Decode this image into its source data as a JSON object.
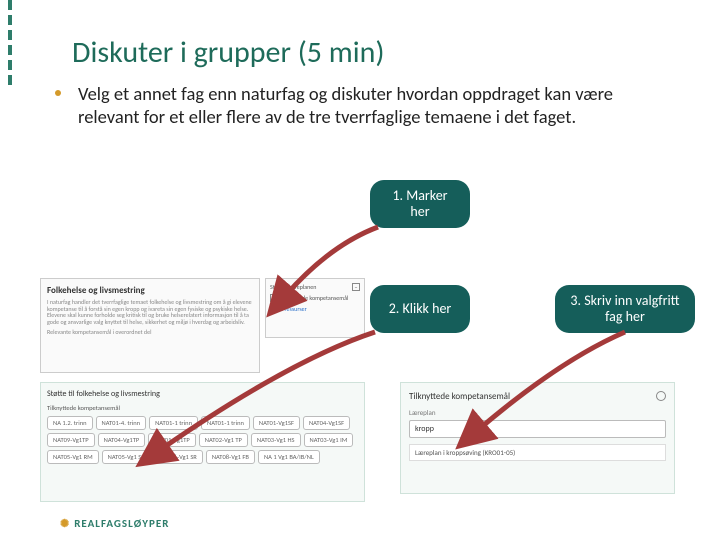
{
  "title": "Diskuter i grupper (5 min)",
  "body": "Velg et annet fag enn naturfag og diskuter hvordan oppdraget kan være relevant for et eller flere av de tre tverrfaglige temaene i det faget.",
  "callouts": {
    "c1": "1. Marker her",
    "c2": "2. Klikk her",
    "c3": "3. Skriv inn valgfritt fag her"
  },
  "shot1": {
    "heading": "Folkehelse og livsmestring",
    "blurb": "I naturfag handler det tverrfaglige temaet folkehelse og livsmestring om å gi elevene kompetanse til å forstå sin egen kropp og ivareta sin egen fysiske og psykiske helse. Elevene skal kunne forholde seg kritisk til og bruke helserelatert informasjon til å ta gode og ansvarlige valg knyttet til helse, sikkerhet og miljø i hverdag og arbeidsliv.",
    "sub": "Relevante kompetansemål i overordnet del"
  },
  "shot2": {
    "heading": "Støtte i læreplanen",
    "chk_label": "Tilknyttede kompetansemål",
    "link": "Vis ressurser"
  },
  "shot3": {
    "heading": "Støtte til folkehelse og livsmestring",
    "sub": "Tilknyttede kompetansemål",
    "pills": [
      "NA 1.2. trinn",
      "NAT01‑4. trinn",
      "NAT01‑1 trinn",
      "NAT01‑1 trinn",
      "NAT01‑Vg1SF",
      "NAT04‑Vg1SF",
      "NAT09‑Vg1TP",
      "NAT04‑Vg1TP",
      "NET01‑Vg1TP",
      "NAT02‑Vg1 TP",
      "NAT03‑Vg1 HS",
      "NAT03‑Vg1 IM",
      "NAT05‑Vg1 RM",
      "NAT05‑Vg1 SR",
      "NAT06‑Vg1 SR",
      "NAT08‑Vg1 FB",
      "NA 1 Vg1 BA/IB/NL"
    ]
  },
  "shot4": {
    "heading": "Tilknyttede kompetansemål",
    "label": "Læreplan",
    "input_value": "kropp",
    "result": "Læreplan i kroppsøving (KRO01‑05)"
  },
  "logo": "REALFAGSLØYPER"
}
